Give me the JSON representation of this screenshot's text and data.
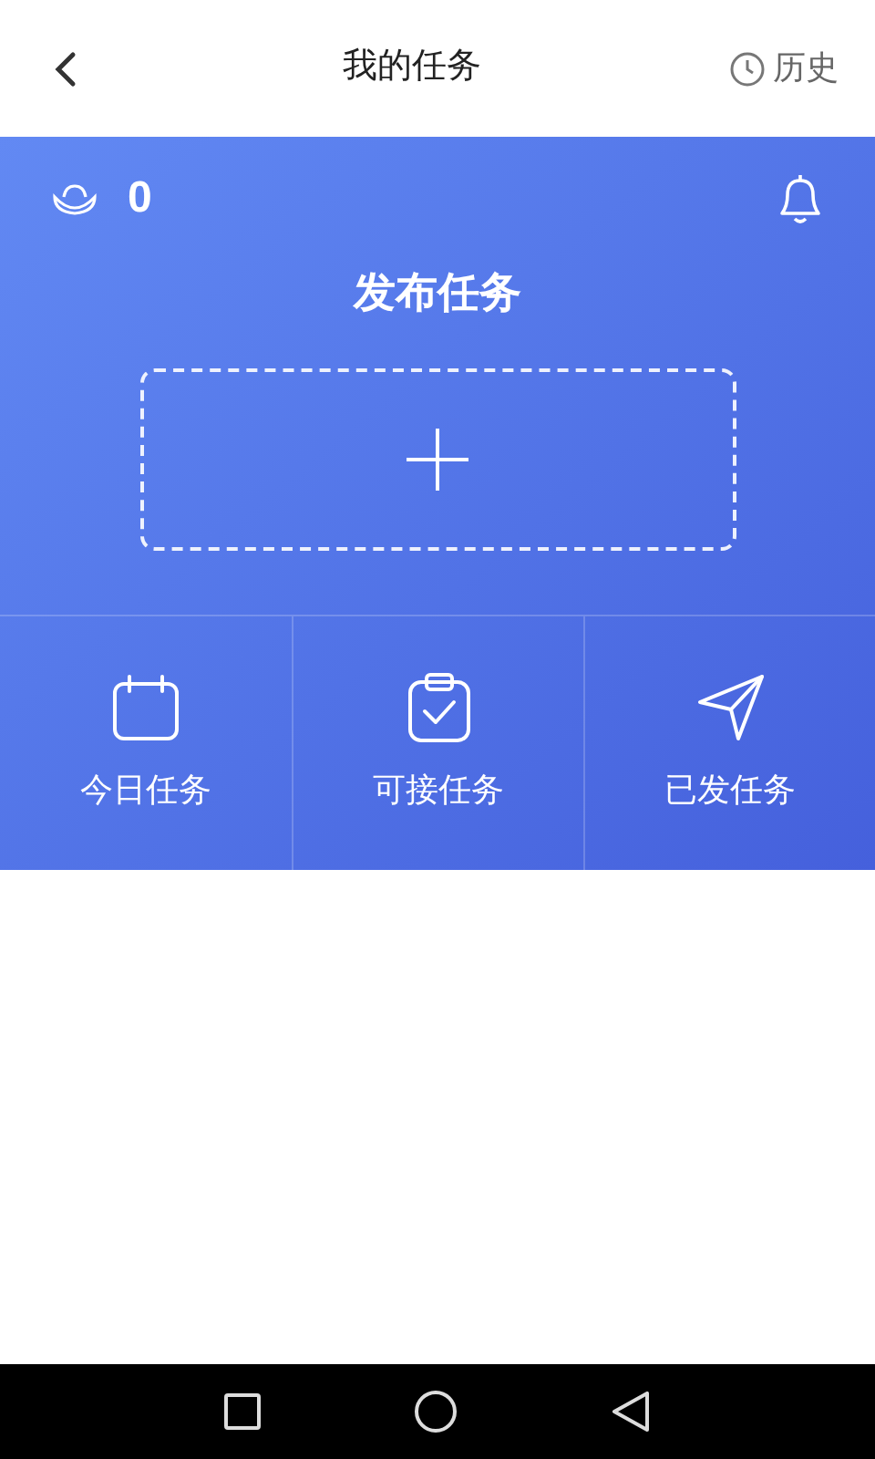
{
  "header": {
    "title": "我的任务",
    "history_label": "历史"
  },
  "wallet": {
    "amount": "0"
  },
  "publish": {
    "title": "发布任务"
  },
  "actions": [
    {
      "kind": "calendar",
      "label": "今日任务"
    },
    {
      "kind": "clipboard",
      "label": "可接任务"
    },
    {
      "kind": "send",
      "label": "已发任务"
    }
  ]
}
